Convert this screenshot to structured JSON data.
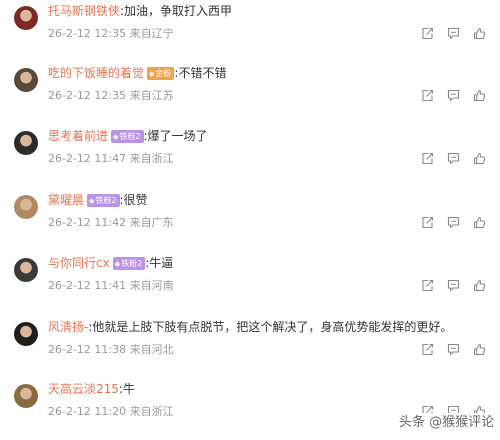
{
  "comments": [
    {
      "username": "托马斯钢铁侠",
      "badge": null,
      "text": ":加油，争取打入西甲",
      "time": "26-2-12 12:35",
      "location": "来自辽宁"
    },
    {
      "username": "吃的下饭睡的着觉",
      "badge": {
        "label": "金粉",
        "color": "#f2a14e"
      },
      "text": ":不错不错",
      "time": "26-2-12 12:35",
      "location": "来自江苏"
    },
    {
      "username": "思考着前进",
      "badge": {
        "label": "铁粉2",
        "color": "#b993e6"
      },
      "text": ":爆了一场了",
      "time": "26-2-12 11:47",
      "location": "来自浙江"
    },
    {
      "username": "黛曜晨",
      "badge": {
        "label": "铁粉2",
        "color": "#b993e6"
      },
      "text": ":很赞",
      "time": "26-2-12 11:42",
      "location": "来自广东"
    },
    {
      "username": "与你同行cx",
      "badge": {
        "label": "铁粉2",
        "color": "#b993e6"
      },
      "text": ":牛逼",
      "time": "26-2-12 11:41",
      "location": "来自河南"
    },
    {
      "username": "风清扬-",
      "badge": null,
      "text": ":他就是上肢下肢有点脱节，把这个解决了，身高优势能发挥的更好。",
      "time": "26-2-12 11:38",
      "location": "来自河北"
    },
    {
      "username": "天高云淡215",
      "badge": null,
      "text": ":牛",
      "time": "26-2-12 11:20",
      "location": "来自浙江"
    }
  ],
  "watermark": "头条 @猴猴评论",
  "colors": {
    "username": "#eb7350",
    "meta": "#999999",
    "icon": "#8a8a8a"
  },
  "icons": [
    "share-icon",
    "comment-icon",
    "like-icon"
  ]
}
